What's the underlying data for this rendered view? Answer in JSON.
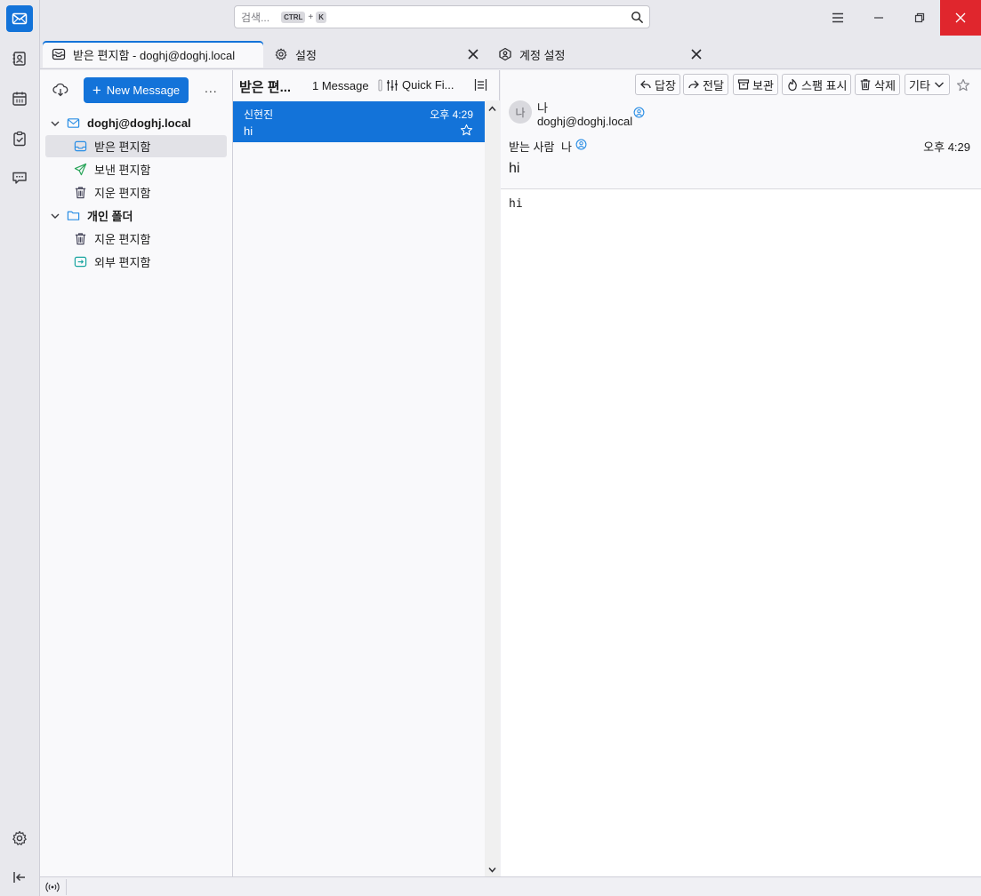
{
  "colors": {
    "accent": "#1373d9",
    "close_button": "#e0262d",
    "selected_row": "#1373d9"
  },
  "spaces": [
    {
      "name": "mail",
      "icon": "mail-icon"
    },
    {
      "name": "address-book",
      "icon": "address-book-icon"
    },
    {
      "name": "calendar",
      "icon": "calendar-icon"
    },
    {
      "name": "tasks",
      "icon": "tasks-icon"
    },
    {
      "name": "chat",
      "icon": "chat-icon"
    },
    {
      "name": "settings",
      "icon": "gear-icon"
    },
    {
      "name": "collapse",
      "icon": "collapse-icon"
    }
  ],
  "search": {
    "placeholder": "검색...",
    "key1": "CTRL",
    "plus": "+",
    "key2": "K"
  },
  "tabs": [
    {
      "label": "받은 편지함 - doghj@doghj.local",
      "icon": "inbox-icon"
    },
    {
      "label": "설정",
      "icon": "gear-icon"
    },
    {
      "label": "계정 설정",
      "icon": "account-settings-icon"
    }
  ],
  "folderpane": {
    "new_message": "New Message",
    "plus": "+",
    "more": "...",
    "account": "doghj@doghj.local",
    "folders": [
      {
        "label": "받은 편지함",
        "icon": "inbox-icon"
      },
      {
        "label": "보낸 편지함",
        "icon": "send-icon"
      },
      {
        "label": "지운 편지함",
        "icon": "trash-icon"
      }
    ],
    "local_folders": "개인 폴더",
    "local_items": [
      {
        "label": "지운 편지함",
        "icon": "trash-icon"
      },
      {
        "label": "외부 편지함",
        "icon": "outbox-icon"
      }
    ]
  },
  "threadpane": {
    "folder_name": "받은 편...",
    "message_count": "1 Message",
    "quick_filter": "Quick Fi...",
    "messages": [
      {
        "sender": "신현진",
        "date": "오후 4:29",
        "subject": "hi",
        "starred": false
      }
    ]
  },
  "message": {
    "buttons": {
      "reply": "답장",
      "forward": "전달",
      "archive": "보관",
      "junk": "스팸 표시",
      "delete": "삭제",
      "more": "기타"
    },
    "avatar_initial": "나",
    "from_name": "나",
    "from_email": "doghj@doghj.local",
    "to_label": "받는 사람",
    "to_value": "나",
    "date": "오후 4:29",
    "subject": "hi",
    "body": "hi"
  }
}
